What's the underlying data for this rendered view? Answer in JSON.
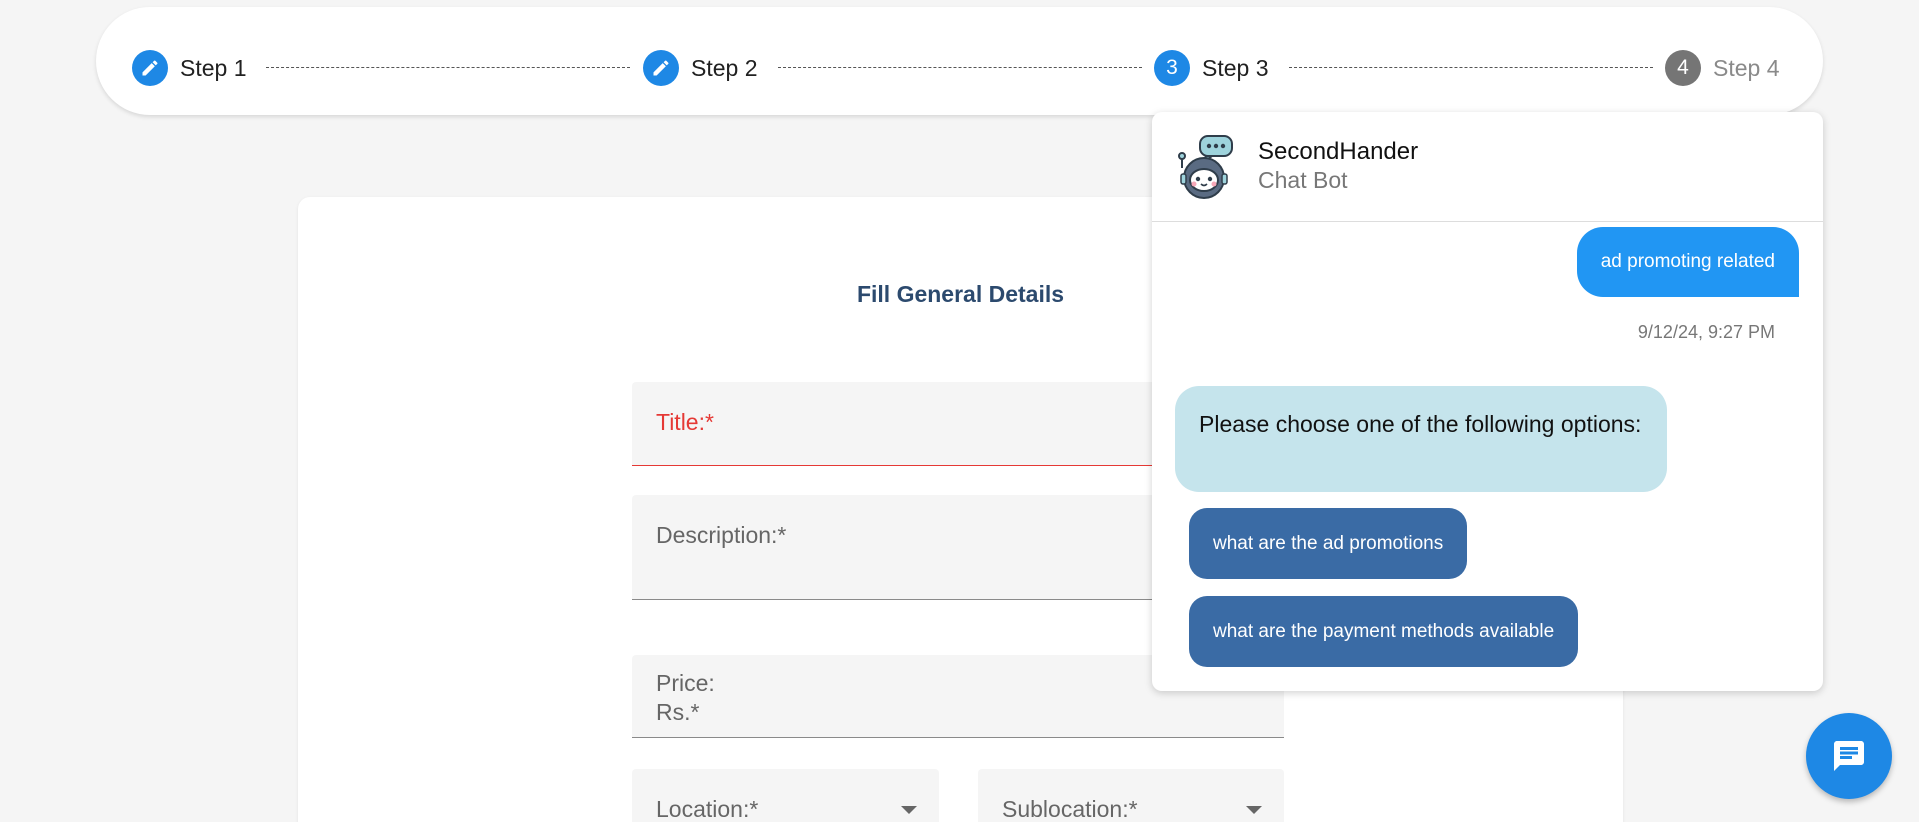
{
  "stepper": {
    "steps": [
      {
        "label": "Step 1",
        "indicator": "edit",
        "state": "done"
      },
      {
        "label": "Step 2",
        "indicator": "edit",
        "state": "done"
      },
      {
        "label": "Step 3",
        "indicator": "3",
        "state": "active"
      },
      {
        "label": "Step 4",
        "indicator": "4",
        "state": "pending"
      }
    ]
  },
  "form": {
    "title": "Fill General Details",
    "title_label": "Title:*",
    "description_label": "Description:*",
    "price_label_line1": "Price:",
    "price_label_line2": "Rs.*",
    "location_label": "Location:*",
    "sublocation_label": "Sublocation:*"
  },
  "chat": {
    "bot_name": "SecondHander",
    "bot_subtitle": "Chat Bot",
    "user_message": "ad promoting related",
    "timestamp": "9/12/24, 9:27 PM",
    "bot_message": "Please choose one of the following options:",
    "options": [
      "what are the ad promotions",
      "what are the payment methods available"
    ]
  },
  "colors": {
    "primary": "#1e88e5",
    "pending": "#757575",
    "error": "#e53935",
    "bot_bubble": "#c5e4ec",
    "option_button": "#3a6ba5",
    "form_title": "#2c4a6e"
  },
  "icons": {
    "step_done": "pencil-icon",
    "fab": "chat-icon",
    "avatar": "robot-icon"
  }
}
